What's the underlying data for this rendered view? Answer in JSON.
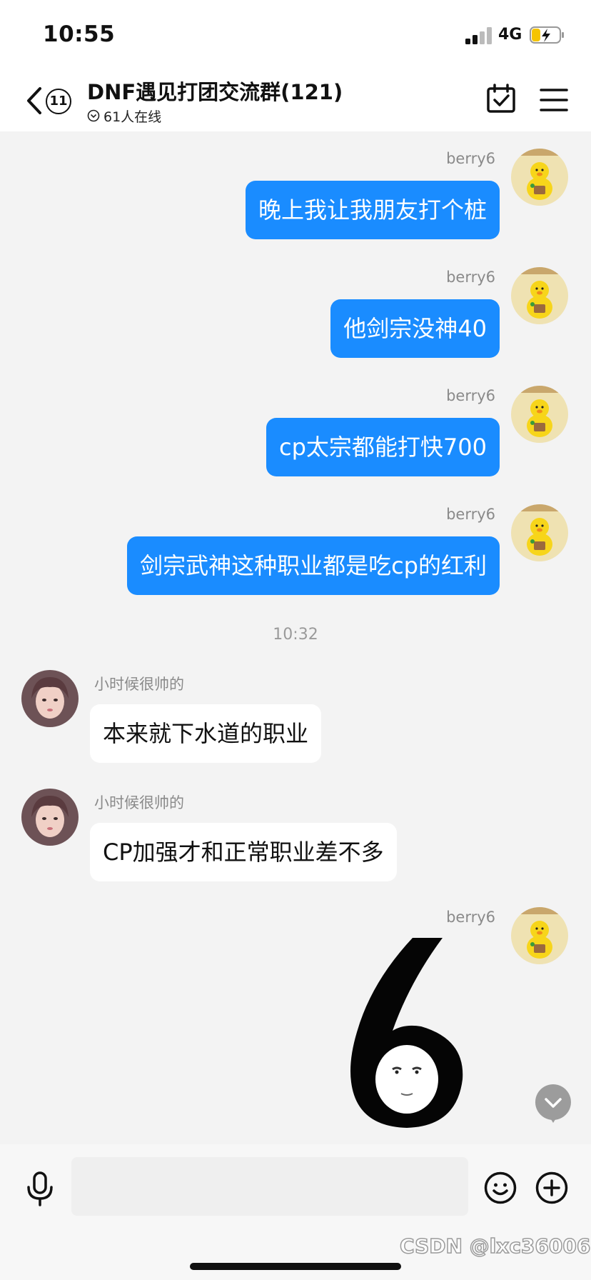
{
  "status_bar": {
    "time": "10:55",
    "network": "4G"
  },
  "header": {
    "unread_count": "11",
    "title": "DNF遇见打团交流群(121)",
    "online": "61人在线"
  },
  "messages": [
    {
      "sender": "berry6",
      "text": "晚上我让我朋友打个桩"
    },
    {
      "sender": "berry6",
      "text": "他剑宗没神40"
    },
    {
      "sender": "berry6",
      "text": "cp太宗都能打快700"
    },
    {
      "sender": "berry6",
      "text": "剑宗武神这种职业都是吃cp的红利"
    },
    {
      "sender": "小时候很帅的",
      "text": "本来就下水道的职业"
    },
    {
      "sender": "小时候很帅的",
      "text": "CP加强才和正常职业差不多"
    },
    {
      "sender": "berry6"
    }
  ],
  "timestamp": "10:32",
  "watermark": "CSDN @lxc36006",
  "colors": {
    "bubble_out": "#1a8cff",
    "bubble_in": "#ffffff",
    "background": "#f3f3f3"
  },
  "icons": [
    "back-icon",
    "calendar-check-icon",
    "menu-icon",
    "mic-icon",
    "emoji-icon",
    "plus-icon",
    "chevron-down-icon"
  ]
}
